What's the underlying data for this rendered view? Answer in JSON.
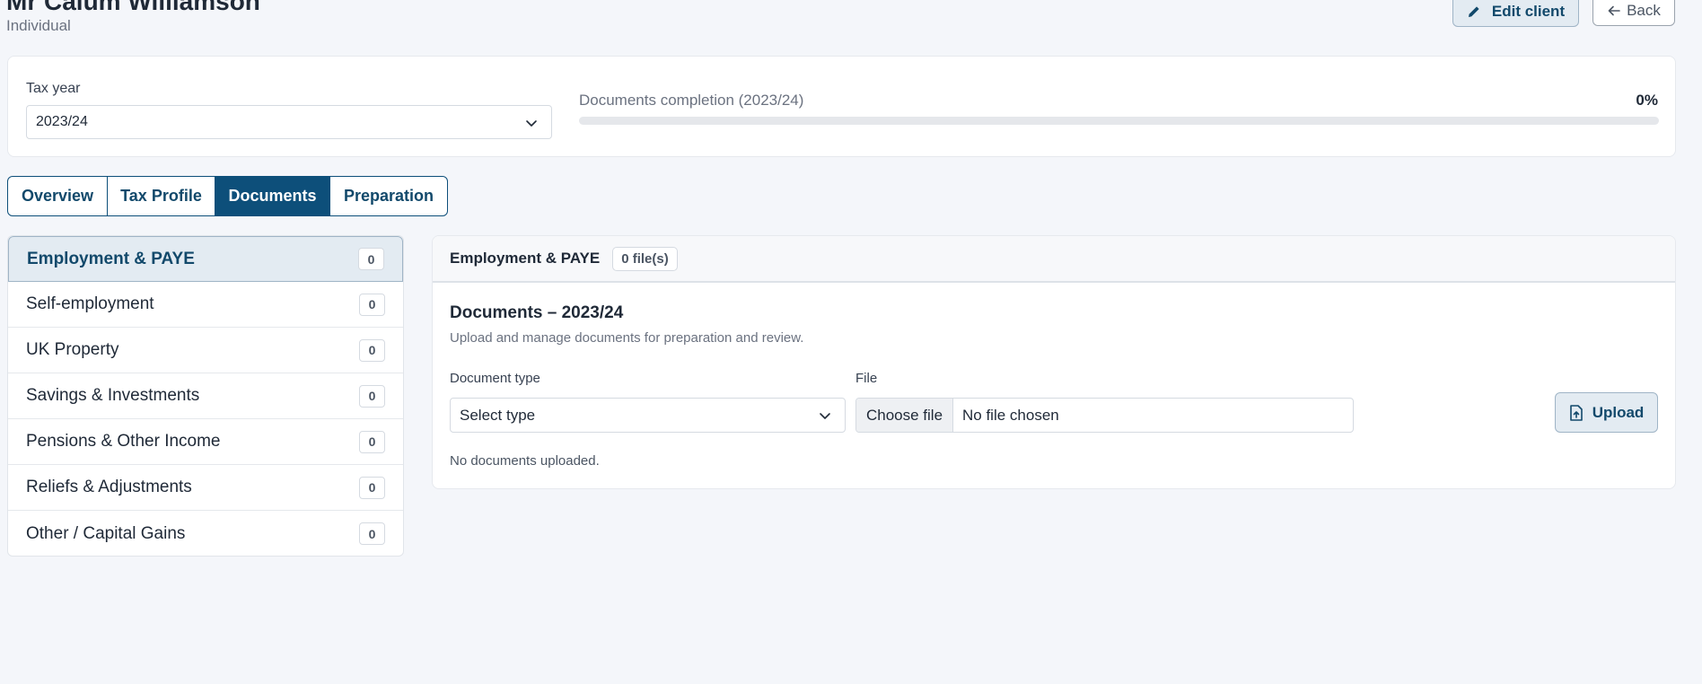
{
  "header": {
    "client_name": "Mr Calum Williamson",
    "client_type": "Individual",
    "edit_label": "Edit client",
    "back_label": "Back"
  },
  "summary": {
    "tax_year_label": "Tax year",
    "tax_year_value": "2023/24",
    "completion_label": "Documents completion (2023/24)",
    "completion_value": "0%",
    "completion_fraction": 0
  },
  "tabs": [
    {
      "label": "Overview",
      "active": false
    },
    {
      "label": "Tax Profile",
      "active": false
    },
    {
      "label": "Documents",
      "active": true
    },
    {
      "label": "Preparation",
      "active": false
    }
  ],
  "categories": [
    {
      "label": "Employment & PAYE",
      "count": "0",
      "active": true
    },
    {
      "label": "Self-employment",
      "count": "0",
      "active": false
    },
    {
      "label": "UK Property",
      "count": "0",
      "active": false
    },
    {
      "label": "Savings & Investments",
      "count": "0",
      "active": false
    },
    {
      "label": "Pensions & Other Income",
      "count": "0",
      "active": false
    },
    {
      "label": "Reliefs & Adjustments",
      "count": "0",
      "active": false
    },
    {
      "label": "Other / Capital Gains",
      "count": "0",
      "active": false
    }
  ],
  "panel": {
    "title": "Employment & PAYE",
    "file_count": "0 file(s)",
    "heading": "Documents – 2023/24",
    "subtitle": "Upload and manage documents for preparation and review.",
    "doc_type_label": "Document type",
    "doc_type_value": "Select type",
    "file_label": "File",
    "choose_file_label": "Choose file",
    "no_file_text": "No file chosen",
    "upload_label": "Upload",
    "empty_text": "No documents uploaded."
  },
  "colors": {
    "brand": "#0d4f7a",
    "brand_light": "#e3ebf2",
    "background": "#f4f6fa"
  }
}
